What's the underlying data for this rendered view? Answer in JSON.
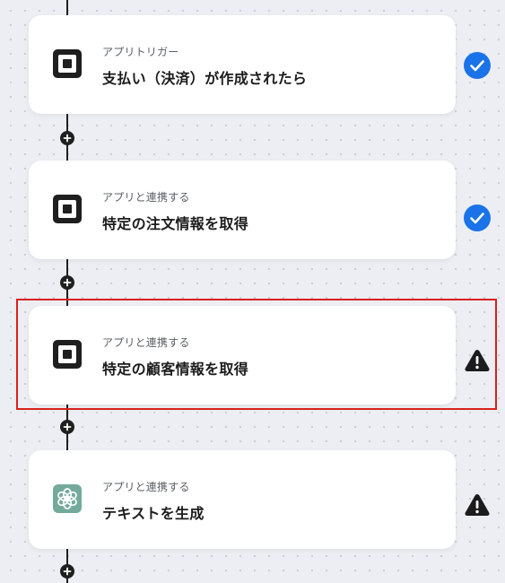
{
  "flow": {
    "steps": [
      {
        "subtitle": "アプリトリガー",
        "title": "支払い（決済）が作成されたら",
        "icon": "square-app-icon",
        "status": "completed"
      },
      {
        "subtitle": "アプリと連携する",
        "title": "特定の注文情報を取得",
        "icon": "square-app-icon",
        "status": "completed"
      },
      {
        "subtitle": "アプリと連携する",
        "title": "特定の顧客情報を取得",
        "icon": "square-app-icon",
        "status": "warning"
      },
      {
        "subtitle": "アプリと連携する",
        "title": "テキストを生成",
        "icon": "openai-app-icon",
        "status": "warning"
      }
    ],
    "highlighted_step": 2
  },
  "colors": {
    "check": "#1a73e8",
    "warning": "#1c1c1c",
    "highlight": "#d9201d",
    "openai": "#74aa9c"
  }
}
